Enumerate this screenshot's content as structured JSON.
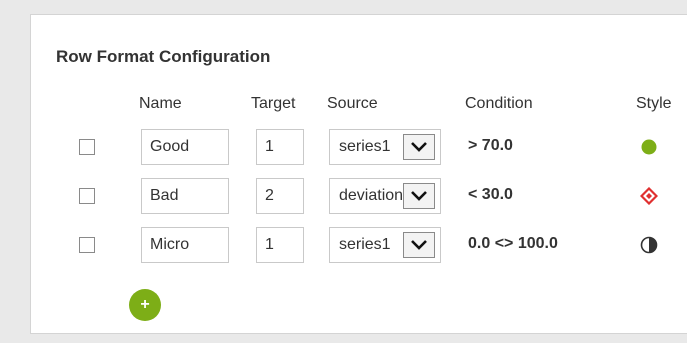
{
  "panel": {
    "title": "Row Format Configuration"
  },
  "columns": {
    "name": "Name",
    "target": "Target",
    "source": "Source",
    "condition": "Condition",
    "style": "Style"
  },
  "rows": [
    {
      "checked": false,
      "name": "Good",
      "target": "1",
      "source": "series1",
      "condition": "> 70.0",
      "style_icon": "green-circle-icon",
      "style_color": "#7dae17"
    },
    {
      "checked": false,
      "name": "Bad",
      "target": "2",
      "source": "deviation",
      "condition": "< 30.0",
      "style_icon": "red-diamond-icon",
      "style_color": "#e03030"
    },
    {
      "checked": false,
      "name": "Micro",
      "target": "1",
      "source": "series1",
      "condition": "0.0 <> 100.0",
      "style_icon": "half-circle-icon",
      "style_color": "#333333"
    }
  ],
  "add_button": {
    "label": "+",
    "icon": "plus-icon",
    "color": "#7dae17"
  }
}
